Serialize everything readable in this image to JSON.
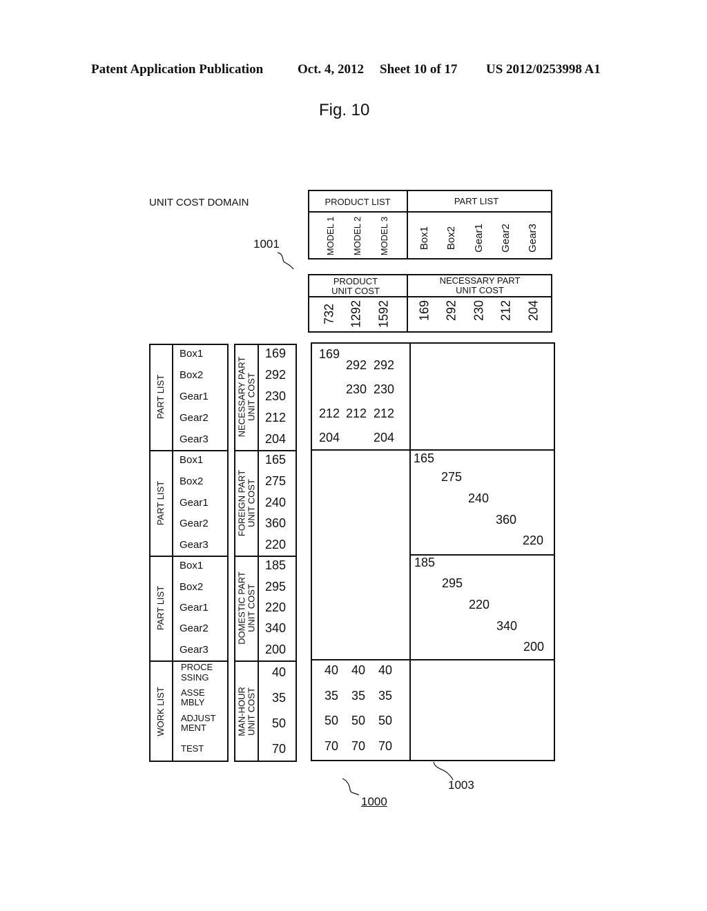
{
  "header": {
    "publication": "Patent Application Publication",
    "date": "Oct. 4, 2012",
    "sheet": "Sheet 10 of 17",
    "number": "US 2012/0253998 A1"
  },
  "figure": {
    "title": "Fig. 10",
    "domain_label": "UNIT COST DOMAIN",
    "refs": {
      "r1001": "1001",
      "r1003": "1003",
      "r1000": "1000"
    }
  },
  "top_table": {
    "product_list_label": "PRODUCT LIST",
    "part_list_label": "PART LIST",
    "products": [
      "MODEL 1",
      "MODEL 2",
      "MODEL 3"
    ],
    "parts": [
      "Box1",
      "Box2",
      "Gear1",
      "Gear2",
      "Gear3"
    ]
  },
  "cost_table": {
    "product_unit_cost_label": [
      "PRODUCT",
      "UNIT COST"
    ],
    "necessary_part_unit_cost_label": [
      "NECESSARY PART",
      "UNIT COST"
    ],
    "product_costs": [
      "732",
      "1292",
      "1592"
    ],
    "part_costs": [
      "169",
      "292",
      "230",
      "212",
      "204"
    ]
  },
  "left_blocks": [
    {
      "list_label": "PART LIST",
      "items": [
        "Box1",
        "Box2",
        "Gear1",
        "Gear2",
        "Gear3"
      ],
      "cost_label": [
        "NECESSARY PART",
        "UNIT COST"
      ],
      "costs": [
        "169",
        "292",
        "230",
        "212",
        "204"
      ]
    },
    {
      "list_label": "PART LIST",
      "items": [
        "Box1",
        "Box2",
        "Gear1",
        "Gear2",
        "Gear3"
      ],
      "cost_label": [
        "FOREIGN PART",
        "UNIT COST"
      ],
      "costs": [
        "165",
        "275",
        "240",
        "360",
        "220"
      ]
    },
    {
      "list_label": "PART LIST",
      "items": [
        "Box1",
        "Box2",
        "Gear1",
        "Gear2",
        "Gear3"
      ],
      "cost_label": [
        "DOMESTIC PART",
        "UNIT COST"
      ],
      "costs": [
        "185",
        "295",
        "220",
        "340",
        "200"
      ]
    },
    {
      "list_label": "WORK LIST",
      "items": [
        [
          "PROCE",
          "SSING"
        ],
        [
          "ASSE",
          "MBLY"
        ],
        [
          "ADJUST",
          "MENT"
        ],
        [
          "TEST"
        ]
      ],
      "cost_label": [
        "MAN-HOUR",
        "UNIT COST"
      ],
      "costs": [
        "40",
        "35",
        "50",
        "70"
      ]
    }
  ],
  "matrix": {
    "necessary_vs_products": [
      [
        "169",
        "",
        ""
      ],
      [
        "",
        "292",
        "292"
      ],
      [
        "",
        "230",
        "230"
      ],
      [
        "212",
        "212",
        "212"
      ],
      [
        "204",
        "",
        "204"
      ]
    ],
    "foreign_diagonal": [
      "165",
      "275",
      "240",
      "360",
      "220"
    ],
    "domestic_diagonal": [
      "185",
      "295",
      "220",
      "340",
      "200"
    ],
    "manhour_vs_products": [
      [
        "40",
        "40",
        "40"
      ],
      [
        "35",
        "35",
        "35"
      ],
      [
        "50",
        "50",
        "50"
      ],
      [
        "70",
        "70",
        "70"
      ]
    ]
  }
}
